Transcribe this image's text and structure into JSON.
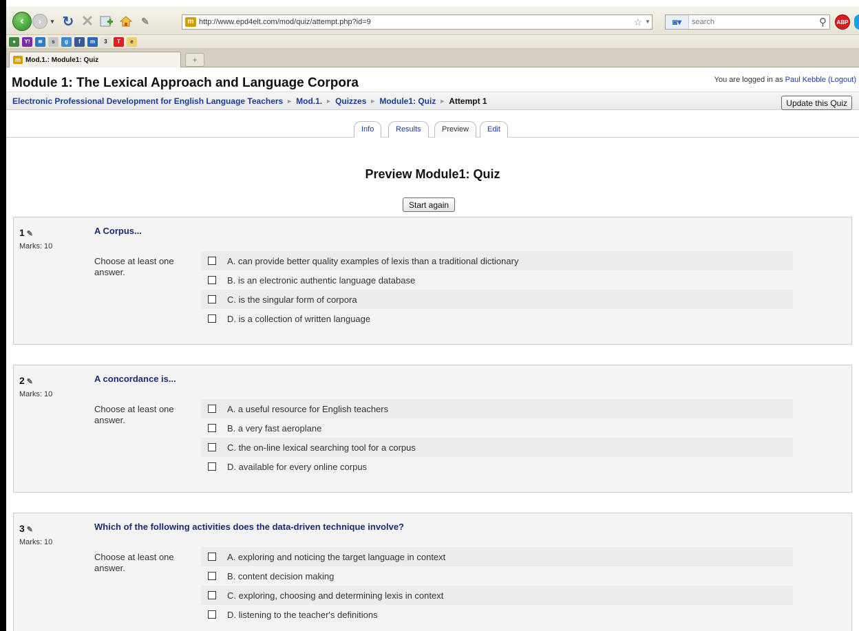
{
  "browser": {
    "url": "http://www.epd4elt.com/mod/quiz/attempt.php?id=9",
    "search_placeholder": "search",
    "tab_title": "Mod.1.: Module1: Quiz",
    "new_tab": "+",
    "abp_label": "ABP"
  },
  "header": {
    "title": "Module 1: The Lexical Approach and Language Corpora",
    "login_prefix": "You are logged in as ",
    "user_name": "Paul Kebble",
    "logout_label": "(Logout)"
  },
  "breadcrumb": {
    "items": [
      "Electronic Professional Development for English Language Teachers",
      "Mod.1.",
      "Quizzes",
      "Module1: Quiz"
    ],
    "current": "Attempt 1",
    "separator": "►"
  },
  "update_button": "Update this Quiz",
  "tabs": [
    "Info",
    "Results",
    "Preview",
    "Edit"
  ],
  "preview_title": "Preview Module1: Quiz",
  "start_again_label": "Start again",
  "questions": [
    {
      "number": "1",
      "marks": "Marks: 10",
      "text": "A Corpus...",
      "instruction": "Choose at least one answer.",
      "answers": [
        "A. can provide better quality examples of lexis than a traditional dictionary",
        "B. is an electronic authentic language database",
        "C. is the singular form of corpora",
        "D. is a collection of written language"
      ]
    },
    {
      "number": "2",
      "marks": "Marks: 10",
      "text": "A concordance is...",
      "instruction": "Choose at least one answer.",
      "answers": [
        "A. a useful resource for English teachers",
        "B. a very fast aeroplane",
        "C. the on-line lexical searching tool for a corpus",
        "D. available for every online corpus"
      ]
    },
    {
      "number": "3",
      "marks": "Marks: 10",
      "text": "Which of the following activities does the data-driven technique involve?",
      "instruction": "Choose at least one answer.",
      "answers": [
        "A. exploring and noticing the target language in context",
        "B. content decision making",
        "C. exploring, choosing and determining lexis in context",
        "D. listening to the teacher's definitions"
      ]
    }
  ]
}
